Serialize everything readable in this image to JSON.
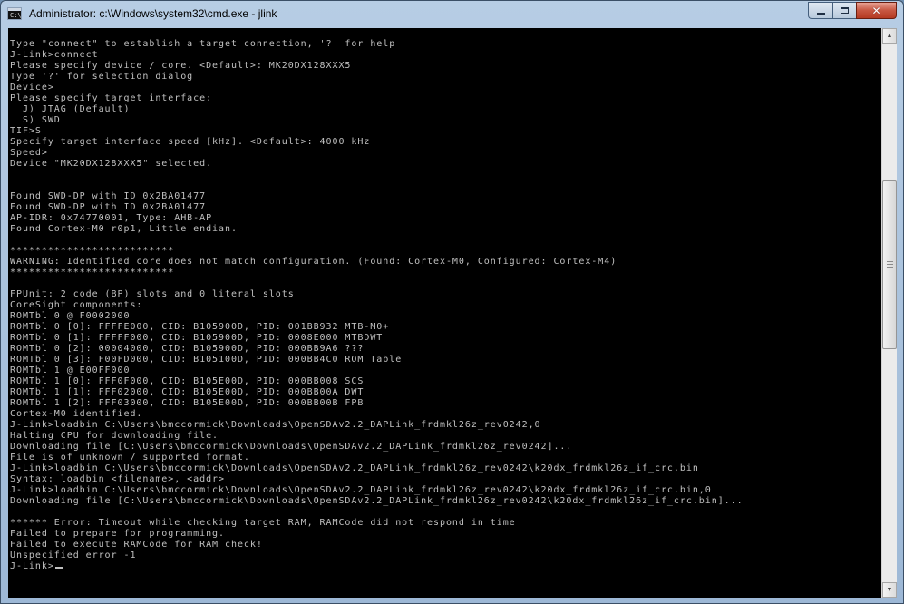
{
  "window": {
    "title": "Administrator: c:\\Windows\\system32\\cmd.exe - jlink",
    "icon": "cmd-icon",
    "icon_text": "C:\\",
    "buttons": {
      "minimize": "minimize-icon",
      "maximize": "maximize-icon",
      "close": "close-icon",
      "close_glyph": "✕"
    }
  },
  "console": {
    "lines": [
      "Type \"connect\" to establish a target connection, '?' for help",
      "J-Link>connect",
      "Please specify device / core. <Default>: MK20DX128XXX5",
      "Type '?' for selection dialog",
      "Device>",
      "Please specify target interface:",
      "  J) JTAG (Default)",
      "  S) SWD",
      "TIF>S",
      "Specify target interface speed [kHz]. <Default>: 4000 kHz",
      "Speed>",
      "Device \"MK20DX128XXX5\" selected.",
      "",
      "",
      "Found SWD-DP with ID 0x2BA01477",
      "Found SWD-DP with ID 0x2BA01477",
      "AP-IDR: 0x74770001, Type: AHB-AP",
      "Found Cortex-M0 r0p1, Little endian.",
      "",
      "**************************",
      "WARNING: Identified core does not match configuration. (Found: Cortex-M0, Configured: Cortex-M4)",
      "**************************",
      "",
      "FPUnit: 2 code (BP) slots and 0 literal slots",
      "CoreSight components:",
      "ROMTbl 0 @ F0002000",
      "ROMTbl 0 [0]: FFFFE000, CID: B105900D, PID: 001BB932 MTB-M0+",
      "ROMTbl 0 [1]: FFFFF000, CID: B105900D, PID: 0008E000 MTBDWT",
      "ROMTbl 0 [2]: 00004000, CID: B105900D, PID: 000BB9A6 ???",
      "ROMTbl 0 [3]: F00FD000, CID: B105100D, PID: 000BB4C0 ROM Table",
      "ROMTbl 1 @ E00FF000",
      "ROMTbl 1 [0]: FFF0F000, CID: B105E00D, PID: 000BB008 SCS",
      "ROMTbl 1 [1]: FFF02000, CID: B105E00D, PID: 000BB00A DWT",
      "ROMTbl 1 [2]: FFF03000, CID: B105E00D, PID: 000BB00B FPB",
      "Cortex-M0 identified.",
      "J-Link>loadbin C:\\Users\\bmccormick\\Downloads\\OpenSDAv2.2_DAPLink_frdmkl26z_rev0242,0",
      "Halting CPU for downloading file.",
      "Downloading file [C:\\Users\\bmccormick\\Downloads\\OpenSDAv2.2_DAPLink_frdmkl26z_rev0242]...",
      "File is of unknown / supported format.",
      "J-Link>loadbin C:\\Users\\bmccormick\\Downloads\\OpenSDAv2.2_DAPLink_frdmkl26z_rev0242\\k20dx_frdmkl26z_if_crc.bin",
      "Syntax: loadbin <filename>, <addr>",
      "J-Link>loadbin C:\\Users\\bmccormick\\Downloads\\OpenSDAv2.2_DAPLink_frdmkl26z_rev0242\\k20dx_frdmkl26z_if_crc.bin,0",
      "Downloading file [C:\\Users\\bmccormick\\Downloads\\OpenSDAv2.2_DAPLink_frdmkl26z_rev0242\\k20dx_frdmkl26z_if_crc.bin]...",
      "",
      "****** Error: Timeout while checking target RAM, RAMCode did not respond in time",
      "Failed to prepare for programming.",
      "Failed to execute RAMCode for RAM check!",
      "Unspecified error -1"
    ],
    "prompt": "J-Link>"
  },
  "scrollbar": {
    "up_icon": "scroll-up-arrow-icon",
    "down_icon": "scroll-down-arrow-icon",
    "position_fraction": 0.28
  },
  "colors": {
    "console_bg": "#000000",
    "console_fg": "#c0c0c0",
    "close_button": "#c75641"
  }
}
